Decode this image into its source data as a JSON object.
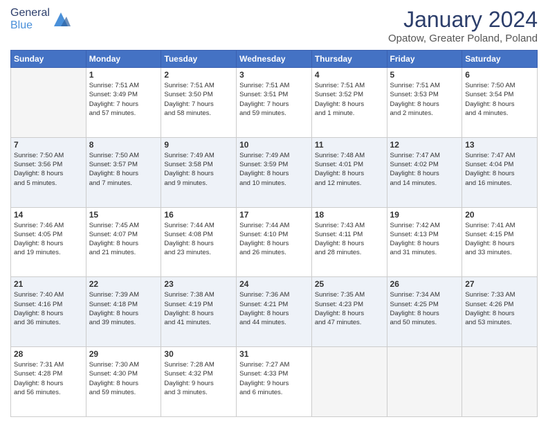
{
  "header": {
    "logo": {
      "line1": "General",
      "line2": "Blue"
    },
    "title": "January 2024",
    "location": "Opatow, Greater Poland, Poland"
  },
  "days_of_week": [
    "Sunday",
    "Monday",
    "Tuesday",
    "Wednesday",
    "Thursday",
    "Friday",
    "Saturday"
  ],
  "weeks": [
    [
      {
        "day": "",
        "info": ""
      },
      {
        "day": "1",
        "info": "Sunrise: 7:51 AM\nSunset: 3:49 PM\nDaylight: 7 hours\nand 57 minutes."
      },
      {
        "day": "2",
        "info": "Sunrise: 7:51 AM\nSunset: 3:50 PM\nDaylight: 7 hours\nand 58 minutes."
      },
      {
        "day": "3",
        "info": "Sunrise: 7:51 AM\nSunset: 3:51 PM\nDaylight: 7 hours\nand 59 minutes."
      },
      {
        "day": "4",
        "info": "Sunrise: 7:51 AM\nSunset: 3:52 PM\nDaylight: 8 hours\nand 1 minute."
      },
      {
        "day": "5",
        "info": "Sunrise: 7:51 AM\nSunset: 3:53 PM\nDaylight: 8 hours\nand 2 minutes."
      },
      {
        "day": "6",
        "info": "Sunrise: 7:50 AM\nSunset: 3:54 PM\nDaylight: 8 hours\nand 4 minutes."
      }
    ],
    [
      {
        "day": "7",
        "info": "Sunrise: 7:50 AM\nSunset: 3:56 PM\nDaylight: 8 hours\nand 5 minutes."
      },
      {
        "day": "8",
        "info": "Sunrise: 7:50 AM\nSunset: 3:57 PM\nDaylight: 8 hours\nand 7 minutes."
      },
      {
        "day": "9",
        "info": "Sunrise: 7:49 AM\nSunset: 3:58 PM\nDaylight: 8 hours\nand 9 minutes."
      },
      {
        "day": "10",
        "info": "Sunrise: 7:49 AM\nSunset: 3:59 PM\nDaylight: 8 hours\nand 10 minutes."
      },
      {
        "day": "11",
        "info": "Sunrise: 7:48 AM\nSunset: 4:01 PM\nDaylight: 8 hours\nand 12 minutes."
      },
      {
        "day": "12",
        "info": "Sunrise: 7:47 AM\nSunset: 4:02 PM\nDaylight: 8 hours\nand 14 minutes."
      },
      {
        "day": "13",
        "info": "Sunrise: 7:47 AM\nSunset: 4:04 PM\nDaylight: 8 hours\nand 16 minutes."
      }
    ],
    [
      {
        "day": "14",
        "info": "Sunrise: 7:46 AM\nSunset: 4:05 PM\nDaylight: 8 hours\nand 19 minutes."
      },
      {
        "day": "15",
        "info": "Sunrise: 7:45 AM\nSunset: 4:07 PM\nDaylight: 8 hours\nand 21 minutes."
      },
      {
        "day": "16",
        "info": "Sunrise: 7:44 AM\nSunset: 4:08 PM\nDaylight: 8 hours\nand 23 minutes."
      },
      {
        "day": "17",
        "info": "Sunrise: 7:44 AM\nSunset: 4:10 PM\nDaylight: 8 hours\nand 26 minutes."
      },
      {
        "day": "18",
        "info": "Sunrise: 7:43 AM\nSunset: 4:11 PM\nDaylight: 8 hours\nand 28 minutes."
      },
      {
        "day": "19",
        "info": "Sunrise: 7:42 AM\nSunset: 4:13 PM\nDaylight: 8 hours\nand 31 minutes."
      },
      {
        "day": "20",
        "info": "Sunrise: 7:41 AM\nSunset: 4:15 PM\nDaylight: 8 hours\nand 33 minutes."
      }
    ],
    [
      {
        "day": "21",
        "info": "Sunrise: 7:40 AM\nSunset: 4:16 PM\nDaylight: 8 hours\nand 36 minutes."
      },
      {
        "day": "22",
        "info": "Sunrise: 7:39 AM\nSunset: 4:18 PM\nDaylight: 8 hours\nand 39 minutes."
      },
      {
        "day": "23",
        "info": "Sunrise: 7:38 AM\nSunset: 4:19 PM\nDaylight: 8 hours\nand 41 minutes."
      },
      {
        "day": "24",
        "info": "Sunrise: 7:36 AM\nSunset: 4:21 PM\nDaylight: 8 hours\nand 44 minutes."
      },
      {
        "day": "25",
        "info": "Sunrise: 7:35 AM\nSunset: 4:23 PM\nDaylight: 8 hours\nand 47 minutes."
      },
      {
        "day": "26",
        "info": "Sunrise: 7:34 AM\nSunset: 4:25 PM\nDaylight: 8 hours\nand 50 minutes."
      },
      {
        "day": "27",
        "info": "Sunrise: 7:33 AM\nSunset: 4:26 PM\nDaylight: 8 hours\nand 53 minutes."
      }
    ],
    [
      {
        "day": "28",
        "info": "Sunrise: 7:31 AM\nSunset: 4:28 PM\nDaylight: 8 hours\nand 56 minutes."
      },
      {
        "day": "29",
        "info": "Sunrise: 7:30 AM\nSunset: 4:30 PM\nDaylight: 8 hours\nand 59 minutes."
      },
      {
        "day": "30",
        "info": "Sunrise: 7:28 AM\nSunset: 4:32 PM\nDaylight: 9 hours\nand 3 minutes."
      },
      {
        "day": "31",
        "info": "Sunrise: 7:27 AM\nSunset: 4:33 PM\nDaylight: 9 hours\nand 6 minutes."
      },
      {
        "day": "",
        "info": ""
      },
      {
        "day": "",
        "info": ""
      },
      {
        "day": "",
        "info": ""
      }
    ]
  ]
}
